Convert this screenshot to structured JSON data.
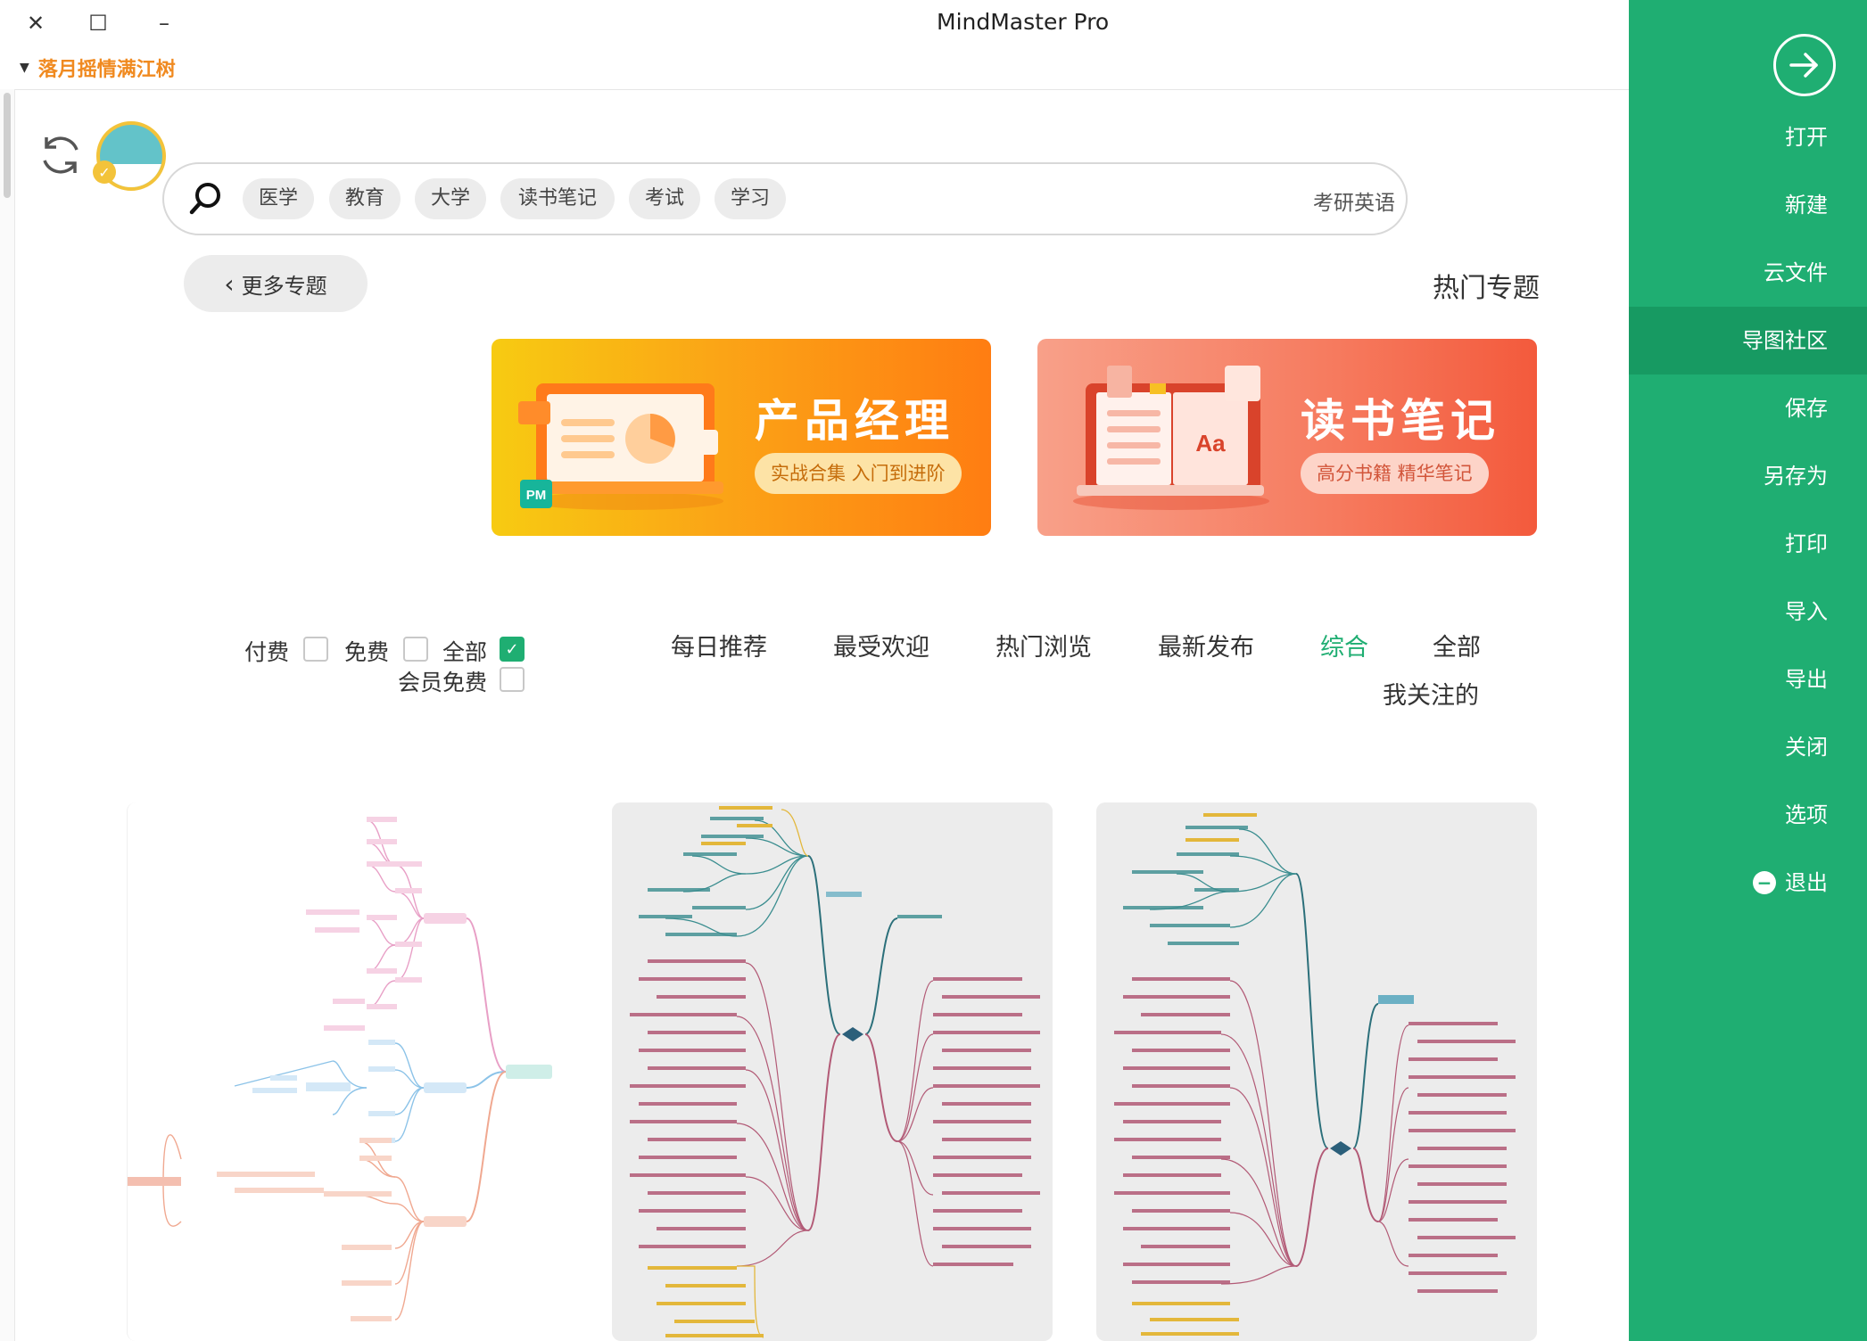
{
  "window": {
    "title": "MindMaster Pro",
    "user": "落月摇情满江树",
    "controls": {
      "close": "✕",
      "maximize": "☐",
      "minimize": "–"
    }
  },
  "search": {
    "tags": [
      "医学",
      "教育",
      "大学",
      "读书笔记",
      "考试",
      "学习"
    ],
    "placeholder": "考研英语"
  },
  "section": {
    "more_topics": "更多专题",
    "hot_title": "热门专题"
  },
  "banners": [
    {
      "title": "产品经理",
      "subtitle": "实战合集 入门到进阶",
      "badge": "PM"
    },
    {
      "title": "读书笔记",
      "subtitle": "高分书籍 精华笔记",
      "badge": "Aa"
    }
  ],
  "filter_tabs": [
    "全部",
    "综合",
    "最新发布",
    "热门浏览",
    "最受欢迎",
    "每日推荐",
    "我关注的"
  ],
  "filter_tabs_active": "综合",
  "price_filters": {
    "all": "全部",
    "free": "免费",
    "paid": "付费",
    "member_free": "会员免费",
    "all_checked": true
  },
  "sidebar": {
    "items": [
      "打开",
      "新建",
      "云文件",
      "导图社区",
      "保存",
      "另存为",
      "打印",
      "导入",
      "导出",
      "关闭",
      "选项",
      "退出"
    ],
    "active": "导图社区"
  },
  "colors": {
    "accent": "#1fae72",
    "sidebar_active": "#179a62",
    "user_name": "#f08a20",
    "banner_pm": "#ff8c15",
    "banner_read": "#f56a4e"
  },
  "icons": {
    "back": "arrow-right-circle-icon",
    "refresh": "refresh-icon",
    "search": "search-icon",
    "chevron": "chevron-left-icon",
    "exit": "minus-circle-icon"
  }
}
